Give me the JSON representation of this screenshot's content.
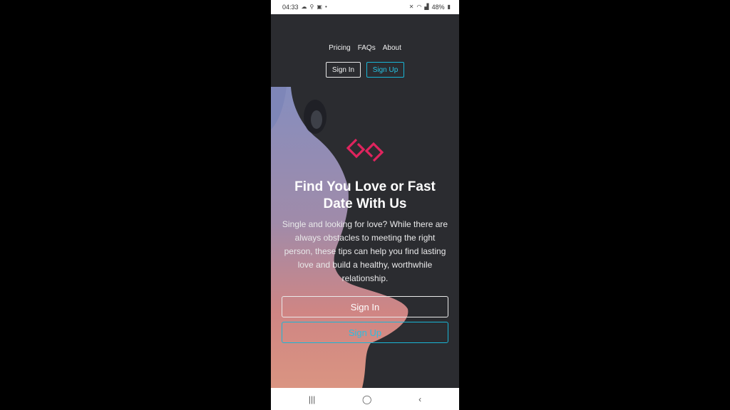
{
  "status_bar": {
    "time": "04:33",
    "left_icons": [
      "cloud-icon",
      "search-icon",
      "image-icon",
      "dot-icon"
    ],
    "right_icons": [
      "mute-icon",
      "wifi-icon",
      "signal-icon"
    ],
    "battery": "48%"
  },
  "nav": {
    "links": [
      "Pricing",
      "FAQs",
      "About"
    ],
    "sign_in": "Sign In",
    "sign_up": "Sign Up"
  },
  "hero": {
    "title": "Find You Love or Fast Date With Us",
    "description": "Single and looking for love? While there are always obstacles to meeting the right person, these tips can help you find lasting love and build a healthy, worthwhile relationship.",
    "sign_in": "Sign In",
    "sign_up": "Sign Up"
  },
  "system_nav": {
    "recents": "|||",
    "home": "◯",
    "back": "‹"
  },
  "colors": {
    "background": "#2b2c30",
    "accent": "#19b6d6",
    "logo": "#e0245e"
  }
}
